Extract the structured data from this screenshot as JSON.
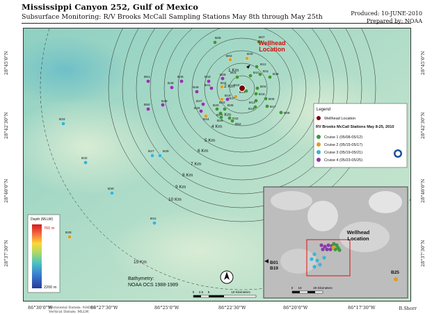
{
  "header": {
    "title": "Mississippi Canyon 252, Gulf of Mexico",
    "subtitle": "Subsurface Monitoring: R/V Brooks McCall Sampling Stations May 8th through May 25th",
    "produced": "Produced: 10-JUNE-2010",
    "prepared": "Prepared by: NOAA"
  },
  "map": {
    "wellhead_label_1": "Wellhead",
    "wellhead_label_2": "Location",
    "range_rings": [
      "1 Km",
      "2 Km",
      "3 Km",
      "4 Km",
      "5 Km",
      "6 Km",
      "7 Km",
      "8 Km",
      "9 Km",
      "10 Km",
      "15 Km"
    ],
    "stations": [
      {
        "id": "B06",
        "cruise": 1
      },
      {
        "id": "B07",
        "cruise": 1
      },
      {
        "id": "B40",
        "cruise": 2
      },
      {
        "id": "B02",
        "cruise": 2
      },
      {
        "id": "B12",
        "cruise": 1
      },
      {
        "id": "B03",
        "cruise": 1
      },
      {
        "id": "B10",
        "cruise": 1
      },
      {
        "id": "B11",
        "cruise": 1
      },
      {
        "id": "B39",
        "cruise": 1
      },
      {
        "id": "B15",
        "cruise": 1
      },
      {
        "id": "B14",
        "cruise": 1
      },
      {
        "id": "B04",
        "cruise": 1
      },
      {
        "id": "B18",
        "cruise": 1
      },
      {
        "id": "B05",
        "cruise": 1
      },
      {
        "id": "B13",
        "cruise": 1
      },
      {
        "id": "B16",
        "cruise": 1
      },
      {
        "id": "B17",
        "cruise": 1
      },
      {
        "id": "B37",
        "cruise": 2
      },
      {
        "id": "B09",
        "cruise": 4
      },
      {
        "id": "B43",
        "cruise": 4
      },
      {
        "id": "B41",
        "cruise": 4
      },
      {
        "id": "B44",
        "cruise": 2
      },
      {
        "id": "B45",
        "cruise": 4
      },
      {
        "id": "B48",
        "cruise": 4
      },
      {
        "id": "B51",
        "cruise": 4
      },
      {
        "id": "B46",
        "cruise": 4
      },
      {
        "id": "B22",
        "cruise": 2
      },
      {
        "id": "B19",
        "cruise": 4
      },
      {
        "id": "B47",
        "cruise": 4
      },
      {
        "id": "B34",
        "cruise": 4
      },
      {
        "id": "B24",
        "cruise": 2
      },
      {
        "id": "B20",
        "cruise": 1
      },
      {
        "id": "B36",
        "cruise": 1
      },
      {
        "id": "B21",
        "cruise": 1
      },
      {
        "id": "B26",
        "cruise": 1
      },
      {
        "id": "B42",
        "cruise": 1
      },
      {
        "id": "B52",
        "cruise": 1
      },
      {
        "id": "B08",
        "cruise": 1
      },
      {
        "id": "B49",
        "cruise": 4
      },
      {
        "id": "B50",
        "cruise": 4
      },
      {
        "id": "B33",
        "cruise": 3
      },
      {
        "id": "B27",
        "cruise": 3
      },
      {
        "id": "B29",
        "cruise": 3
      },
      {
        "id": "B32",
        "cruise": 3
      },
      {
        "id": "B30",
        "cruise": 3
      },
      {
        "id": "B31",
        "cruise": 3
      },
      {
        "id": "B28",
        "cruise": 2
      },
      {
        "id": "B01",
        "cruise": 2
      }
    ],
    "lon_ticks": [
      "86°30'0\"W",
      "86°27'30\"W",
      "86°25'0\"W",
      "86°22'30\"W",
      "86°20'0\"W",
      "86°17'30\"W"
    ],
    "lat_ticks_left": [
      "28°45'0\"N",
      "28°42'30\"N",
      "28°40'0\"N",
      "28°37'30\"N"
    ],
    "lat_ticks_right": [
      "28°45'0\"N",
      "28°42'30\"N",
      "28°40'0\"N",
      "28°37'30\"N"
    ],
    "bathymetry_1": "Bathymetry:",
    "bathymetry_2": "NOAA OCS 1988-1989",
    "scale_ticks": [
      "0",
      "2.5",
      "5",
      "10 Kilometers"
    ],
    "credit": "B.Shorr",
    "datum_1": "Horizontal Datum: NAD83",
    "datum_2": "Vertical Datum: MLLW"
  },
  "legend": {
    "title": "Legend",
    "wellhead": "Wellhead Location",
    "subtitle": "RV Brooks McCall Stations May 8-25, 2010",
    "cruises": [
      {
        "label": "Cruise 1 (05/08-05/12)",
        "color": "#3a9a3a"
      },
      {
        "label": "Cruise 2 (05/15-05/17)",
        "color": "#d4a12a"
      },
      {
        "label": "Cruise 3 (05/19-05/21)",
        "color": "#35b6d8"
      },
      {
        "label": "Cruise 4 (05/23-05/25)",
        "color": "#8a3aaa"
      }
    ]
  },
  "depth_legend": {
    "title": "Depth (MLLW)",
    "top": "760 m",
    "bottom": "2200 m"
  },
  "inset": {
    "label_1": "Wellhead",
    "label_2": "Location",
    "b01": "B01",
    "b19": "B19",
    "b25": "B25",
    "scale_ticks": [
      "0",
      "10",
      "20 Kilometers"
    ]
  }
}
